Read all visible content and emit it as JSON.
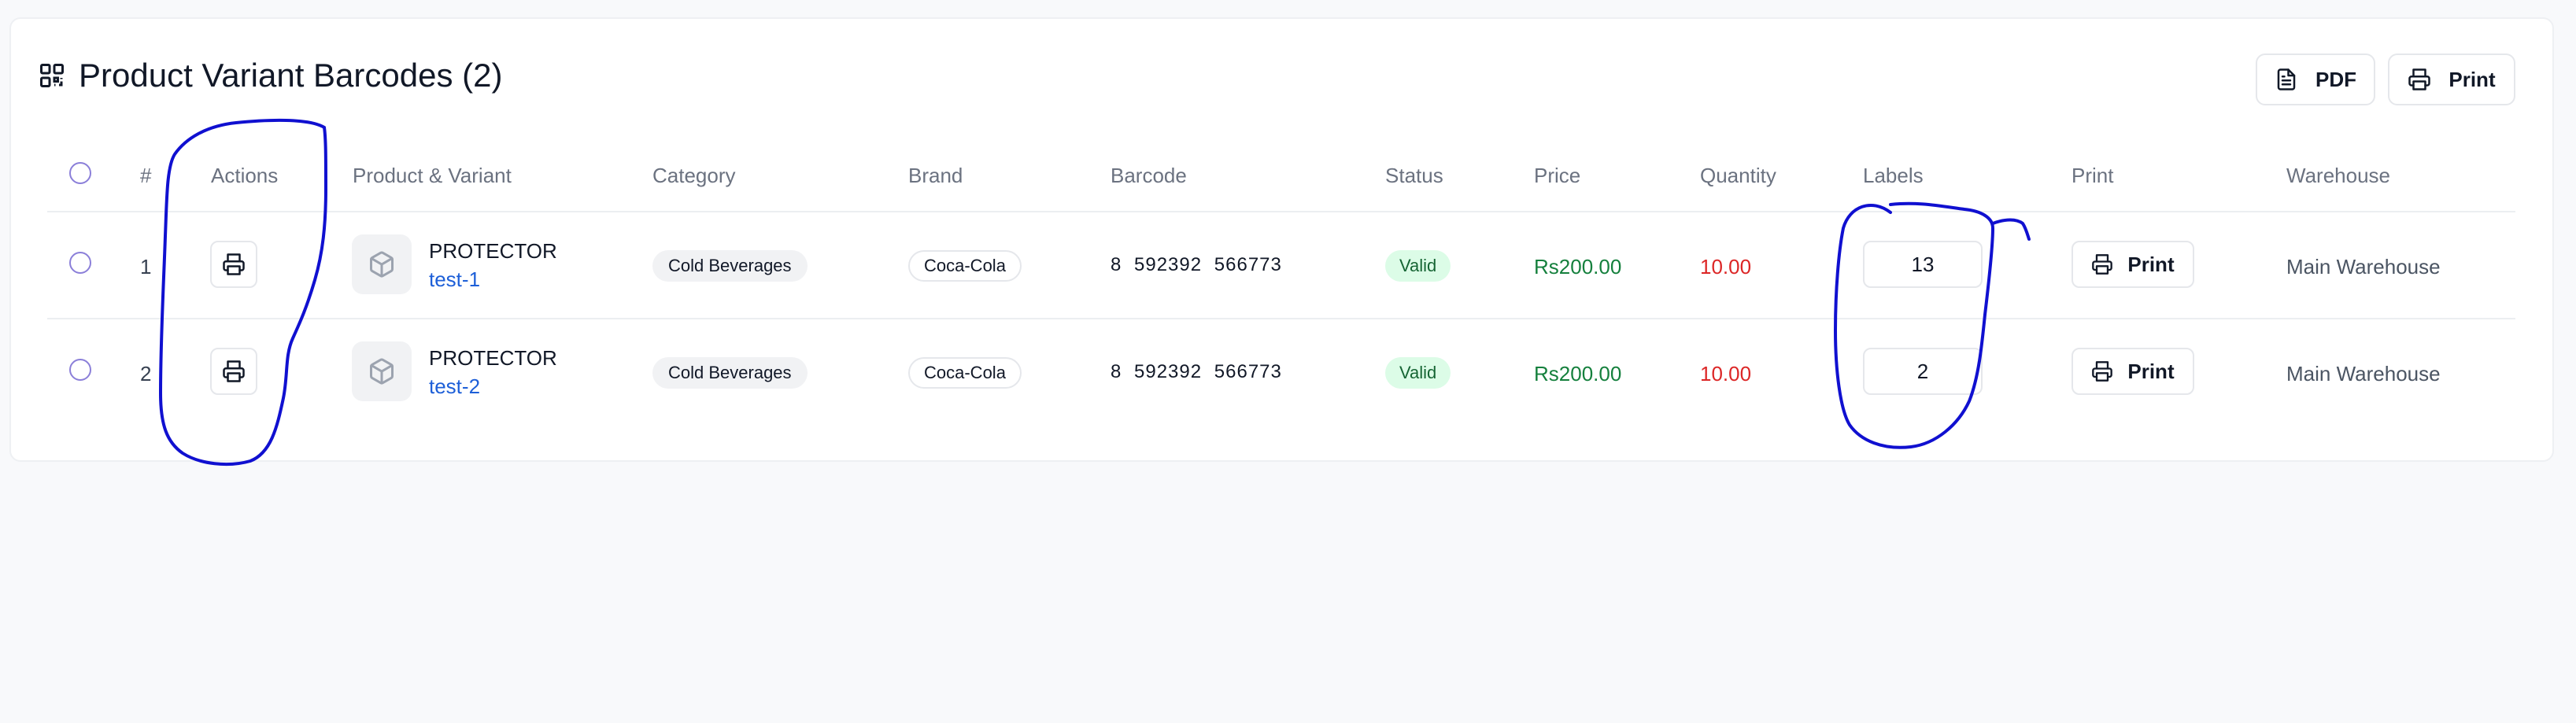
{
  "header": {
    "title": "Product Variant Barcodes (2)",
    "icon": "qr-code-icon",
    "pdf_label": "PDF",
    "print_label": "Print"
  },
  "table": {
    "columns": [
      "#",
      "Actions",
      "Product & Variant",
      "Category",
      "Brand",
      "Barcode",
      "Status",
      "Price",
      "Quantity",
      "Labels",
      "Print",
      "Warehouse"
    ],
    "rows": [
      {
        "index": "1",
        "product": "PROTECTOR",
        "variant": "test-1",
        "category": "Cold Beverages",
        "brand": "Coca-Cola",
        "barcode": "8 592392 566773",
        "status": "Valid",
        "price": "Rs200.00",
        "quantity": "10.00",
        "labels": "13",
        "print_label": "Print",
        "warehouse": "Main Warehouse"
      },
      {
        "index": "2",
        "product": "PROTECTOR",
        "variant": "test-2",
        "category": "Cold Beverages",
        "brand": "Coca-Cola",
        "barcode": "8 592392 566773",
        "status": "Valid",
        "price": "Rs200.00",
        "quantity": "10.00",
        "labels": "2",
        "print_label": "Print",
        "warehouse": "Main Warehouse"
      }
    ]
  },
  "colors": {
    "accent_radio": "#8b7fd9",
    "variant_link": "#1d5fd8",
    "price": "#15803d",
    "quantity": "#dc2626",
    "valid_bg": "#dcfce7",
    "annotation_ink": "#1010d0"
  }
}
